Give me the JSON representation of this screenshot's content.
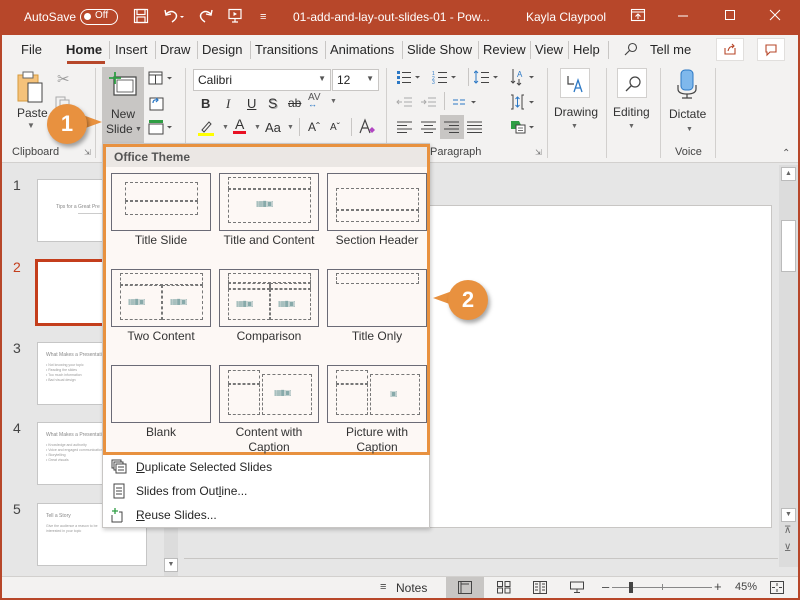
{
  "titlebar": {
    "autosave_label": "AutoSave",
    "autosave_state": "Off",
    "doc_title": "01-add-and-lay-out-slides-01  -  Pow...",
    "user_name": "Kayla Claypool",
    "icons": [
      "save-icon",
      "undo-icon",
      "redo-icon",
      "present-icon",
      "customize-icon",
      "ribbon-display-icon",
      "minimize-icon",
      "maximize-icon",
      "close-icon"
    ]
  },
  "tabs": {
    "items": [
      "File",
      "Home",
      "Insert",
      "Draw",
      "Design",
      "Transitions",
      "Animations",
      "Slide Show",
      "Review",
      "View",
      "Help"
    ],
    "active": "Home",
    "tell_me": "Tell me"
  },
  "ribbon": {
    "clipboard": {
      "label": "Clipboard",
      "paste": "Paste"
    },
    "slides": {
      "new_slide_line1": "New",
      "new_slide_line2": "Slide"
    },
    "font": {
      "font_name": "Calibri",
      "font_size": "12",
      "bold": "B",
      "italic": "I",
      "underline": "U",
      "shadow": "S",
      "strike": "ab",
      "spacing": "AV",
      "change_case": "Aa",
      "grow": "Aˆ",
      "shrink": "Aˇ",
      "font_color": "A"
    },
    "paragraph": {
      "label": "Paragraph"
    },
    "drawing": {
      "label": "Drawing"
    },
    "editing": {
      "label": "Editing"
    },
    "voice": {
      "dictate": "Dictate",
      "label": "Voice"
    }
  },
  "slides_pane": {
    "selected": 2,
    "slides": [
      {
        "number": "1",
        "title": "Tips for a Great Pre",
        "bullets": []
      },
      {
        "number": "2",
        "title": "",
        "bullets": []
      },
      {
        "number": "3",
        "title": "What Makes a Presentation B",
        "bullets": [
          "• Not knowing your topic",
          "• Reading the slides",
          "• Too much information",
          "• Bad visual design"
        ]
      },
      {
        "number": "4",
        "title": "What Makes a Presentation G",
        "bullets": [
          "• Knowledge and authority",
          "• Voice and engaged communication",
          "• Storytelling",
          "• Great visuals"
        ]
      },
      {
        "number": "5",
        "title": "Tell a Story",
        "bullets": [
          "Give the audience a reason to be",
          "interested in your topic"
        ]
      }
    ]
  },
  "dropdown": {
    "theme_header": "Office Theme",
    "layouts": [
      {
        "name": "Title Slide"
      },
      {
        "name": "Title and Content"
      },
      {
        "name": "Section Header"
      },
      {
        "name": "Two Content"
      },
      {
        "name": "Comparison"
      },
      {
        "name": "Title Only"
      },
      {
        "name": "Blank"
      },
      {
        "name": "Content with",
        "name2": "Caption"
      },
      {
        "name": "Picture with",
        "name2": "Caption"
      }
    ],
    "menu": [
      {
        "accel": "D",
        "rest": "uplicate Selected Slides"
      },
      {
        "pre": "Slides from Out",
        "accel": "l",
        "rest": "ine..."
      },
      {
        "accel": "R",
        "rest": "euse Slides..."
      }
    ]
  },
  "callouts": {
    "one": "1",
    "two": "2"
  },
  "statusbar": {
    "notes": "Notes",
    "zoom_percent": "45%",
    "zoom_value": 45
  },
  "colors": {
    "accent": "#b7472a",
    "callout": "#e8913f"
  }
}
